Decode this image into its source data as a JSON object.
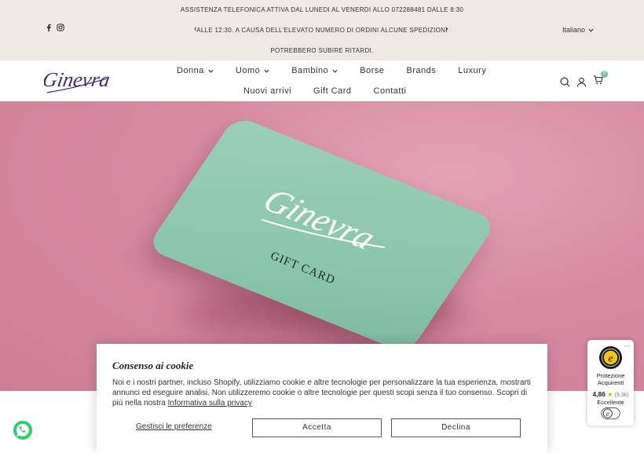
{
  "announcement": {
    "line1": "ASSISTENZA TELEFONICA ATTIVA DAL LUNEDI AL VENERDI ALLO 072288481 DALLE 8:30",
    "line2": "ALLE 12:30. A CAUSA DELL'ELEVATO NUMERO DI ORDINI ALCUNE SPEDIZIONI",
    "line3": "POTREBBERO SUBIRE RITARDI.",
    "prev_arrow": "‹",
    "next_arrow": "›",
    "language": "Italiano"
  },
  "header": {
    "logo_text": "Ginevra",
    "nav_primary": [
      {
        "label": "Donna",
        "dropdown": true
      },
      {
        "label": "Uomo",
        "dropdown": true
      },
      {
        "label": "Bambino",
        "dropdown": true
      },
      {
        "label": "Borse",
        "dropdown": false
      },
      {
        "label": "Brands",
        "dropdown": false
      },
      {
        "label": "Luxury",
        "dropdown": false
      }
    ],
    "nav_secondary": [
      {
        "label": "Nuovi arrivi"
      },
      {
        "label": "Gift Card"
      },
      {
        "label": "Contatti"
      }
    ],
    "icons": [
      "search-icon",
      "account-icon",
      "cart-icon"
    ],
    "cart_count": "0",
    "accent_color": "#7fb9a0"
  },
  "hero": {
    "card_logo": "Ginevra",
    "card_label": "GIFT CARD",
    "background_color": "#d68aa2",
    "card_color": "#8cc6ac"
  },
  "cookie": {
    "title": "Consenso ai cookie",
    "body": "Noi e i nostri partner, incluso Shopify, utilizziamo cookie e altre tecnologie per personalizzare la tua esperienza, mostrarti annunci ed eseguire analisi. Non utilizzeremo cookie o altre tecnologie per questi scopi senza il tuo consenso. Scopri di più nella nostra ",
    "privacy_link": "Informativa sulla privacy",
    "manage_label": "Gestisci le preferenze",
    "accept_label": "Accetta",
    "decline_label": "Declina"
  },
  "trusted_shops": {
    "title": "Protezione Acquirenti",
    "rating": "4,86",
    "count": "(9,3k)",
    "label": "Eccellente",
    "menu": "..."
  },
  "whatsapp": {
    "icon": "whatsapp-icon",
    "color": "#25d366"
  }
}
